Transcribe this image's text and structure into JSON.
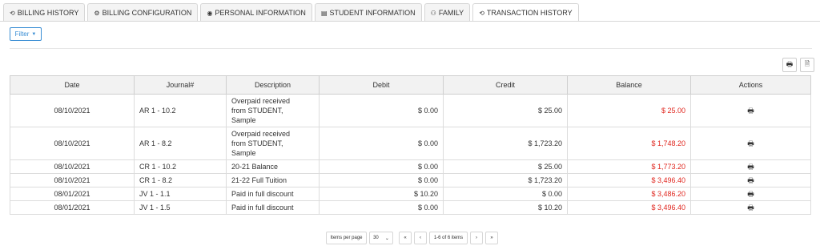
{
  "tabs": [
    {
      "label": "BILLING HISTORY",
      "icon": "history-icon",
      "glyph": "⟲"
    },
    {
      "label": "BILLING CONFIGURATION",
      "icon": "gear-icon",
      "glyph": "⚙"
    },
    {
      "label": "PERSONAL INFORMATION",
      "icon": "user-circle-icon",
      "glyph": "◉"
    },
    {
      "label": "STUDENT INFORMATION",
      "icon": "id-card-icon",
      "glyph": "▤"
    },
    {
      "label": "FAMILY",
      "icon": "users-icon",
      "glyph": "⚇"
    },
    {
      "label": "TRANSACTION HISTORY",
      "icon": "history-icon",
      "glyph": "⟲",
      "active": true
    }
  ],
  "filter": {
    "label": "Filter",
    "caret": "▼"
  },
  "toolbar": {
    "print_icon": "print-icon",
    "export_icon": "export-file-icon"
  },
  "table": {
    "columns": [
      "Date",
      "Journal#",
      "Description",
      "Debit",
      "Credit",
      "Balance",
      "Actions"
    ],
    "rows": [
      {
        "date": "08/10/2021",
        "journal": "AR 1 - 10.2",
        "description": [
          "Overpaid received",
          "from STUDENT,",
          "Sample"
        ],
        "debit": "$ 0.00",
        "credit": "$ 25.00",
        "balance": "$ 25.00"
      },
      {
        "date": "08/10/2021",
        "journal": "AR 1 - 8.2",
        "description": [
          "Overpaid received",
          "from STUDENT,",
          "Sample"
        ],
        "debit": "$ 0.00",
        "credit": "$ 1,723.20",
        "balance": "$ 1,748.20"
      },
      {
        "date": "08/10/2021",
        "journal": "CR 1 - 10.2",
        "description": [
          "20-21 Balance"
        ],
        "debit": "$ 0.00",
        "credit": "$ 25.00",
        "balance": "$ 1,773.20"
      },
      {
        "date": "08/10/2021",
        "journal": "CR 1 - 8.2",
        "description": [
          "21-22 Full Tuition"
        ],
        "debit": "$ 0.00",
        "credit": "$ 1,723.20",
        "balance": "$ 3,496.40"
      },
      {
        "date": "08/01/2021",
        "journal": "JV 1 - 1.1",
        "description": [
          "Paid in full discount"
        ],
        "debit": "$ 10.20",
        "credit": "$ 0.00",
        "balance": "$ 3,486.20"
      },
      {
        "date": "08/01/2021",
        "journal": "JV 1 - 1.5",
        "description": [
          "Paid in full discount"
        ],
        "debit": "$ 0.00",
        "credit": "$ 10.20",
        "balance": "$ 3,496.40"
      }
    ],
    "action_icon": "print-icon",
    "balance_color": "#e0271f"
  },
  "pagination": {
    "items_per_page_label": "Items per page",
    "items_per_page_value": "30",
    "range_label": "1-6 of 6 items",
    "first": "«",
    "prev": "‹",
    "next": "›",
    "last": "»"
  }
}
